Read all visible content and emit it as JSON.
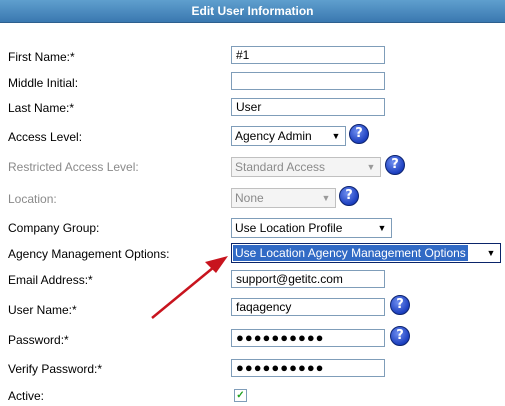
{
  "header": {
    "title": "Edit User Information"
  },
  "form": {
    "first_name": {
      "label": "First Name:*",
      "value": "#1"
    },
    "middle_initial": {
      "label": "Middle Initial:",
      "value": ""
    },
    "last_name": {
      "label": "Last Name:*",
      "value": "User"
    },
    "access_level": {
      "label": "Access Level:",
      "value": "Agency Admin"
    },
    "restricted_access_level": {
      "label": "Restricted Access Level:",
      "value": "Standard Access"
    },
    "location": {
      "label": "Location:",
      "value": "None"
    },
    "company_group": {
      "label": "Company Group:",
      "value": "Use Location Profile"
    },
    "agency_management": {
      "label": "Agency Management Options:",
      "value": "Use Location Agency Management Options"
    },
    "email": {
      "label": "Email Address:*",
      "value": "support@getitc.com"
    },
    "username": {
      "label": "User Name:*",
      "value": "faqagency"
    },
    "password": {
      "label": "Password:*",
      "value": "●●●●●●●●●●"
    },
    "verify_password": {
      "label": "Verify Password:*",
      "value": "●●●●●●●●●●"
    },
    "active": {
      "label": "Active:",
      "checked": true
    }
  },
  "icons": {
    "help": "?",
    "dropdown": "▼",
    "check": "✓"
  },
  "colors": {
    "header_bg": "#4a86bd",
    "arrow": "#c8141e",
    "selection": "#316ac5"
  }
}
